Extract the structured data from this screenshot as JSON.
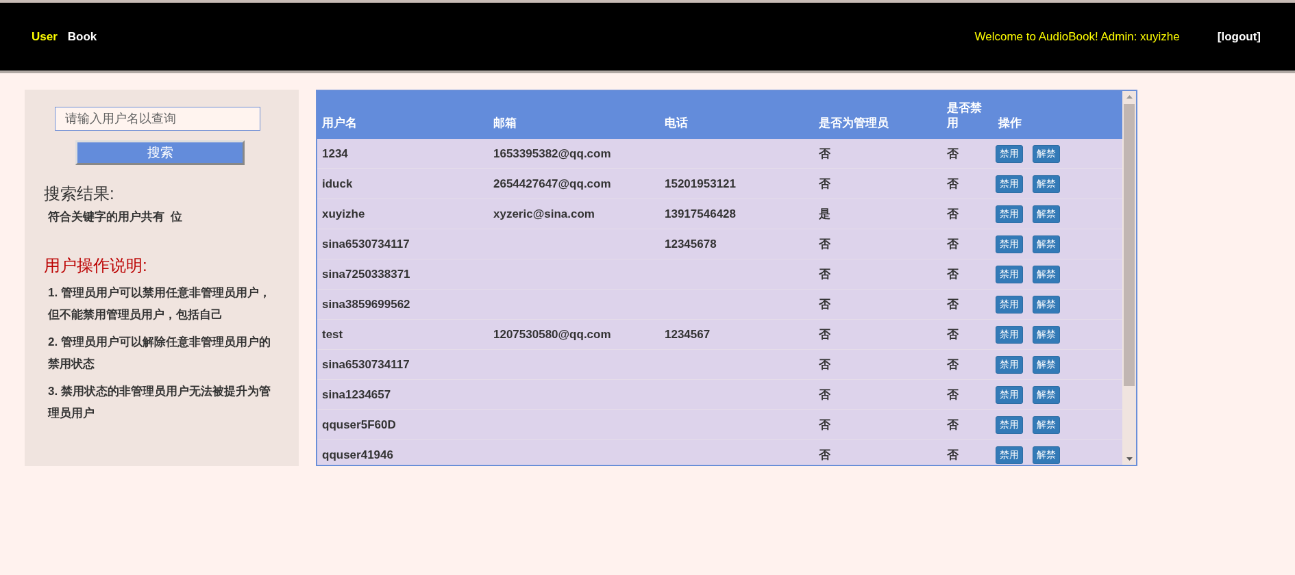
{
  "nav": {
    "items": [
      {
        "label": "User",
        "selected": true
      },
      {
        "label": "Book",
        "selected": false
      }
    ],
    "welcome": "Welcome to AudioBook! Admin: xuyizhe",
    "logout": "[logout]"
  },
  "sidebar": {
    "search": {
      "placeholder": "请输入用户名以查询",
      "button": "搜索"
    },
    "result_title": "搜索结果:",
    "result_text": "符合关键字的用户共有  位",
    "help_title": "用户操作说明:",
    "help_items": [
      "1. 管理员用户可以禁用任意非管理员用户，但不能禁用管理员用户，包括自己",
      "2. 管理员用户可以解除任意非管理员用户的禁用状态",
      "3. 禁用状态的非管理员用户无法被提升为管理员用户"
    ]
  },
  "table": {
    "columns": [
      "用户名",
      "邮箱",
      "电话",
      "是否为管理员",
      "是否禁用",
      "操作"
    ],
    "rows": [
      {
        "username": "1234",
        "email": "1653395382@qq.com",
        "phone": "",
        "admin": "否",
        "banned": "否",
        "actions": [
          "禁用",
          "解禁"
        ]
      },
      {
        "username": "iduck",
        "email": "2654427647@qq.com",
        "phone": "15201953121",
        "admin": "否",
        "banned": "否",
        "actions": [
          "禁用",
          "解禁"
        ]
      },
      {
        "username": "xuyizhe",
        "email": "xyzeric@sina.com",
        "phone": "13917546428",
        "admin": "是",
        "banned": "否",
        "actions": [
          "禁用",
          "解禁"
        ]
      },
      {
        "username": "sina6530734117",
        "email": "",
        "phone": "12345678",
        "admin": "否",
        "banned": "否",
        "actions": [
          "禁用",
          "解禁"
        ]
      },
      {
        "username": "sina7250338371",
        "email": "",
        "phone": "",
        "admin": "否",
        "banned": "否",
        "actions": [
          "禁用",
          "解禁"
        ]
      },
      {
        "username": "sina3859699562",
        "email": "",
        "phone": "",
        "admin": "否",
        "banned": "否",
        "actions": [
          "禁用",
          "解禁"
        ]
      },
      {
        "username": "test",
        "email": "1207530580@qq.com",
        "phone": "1234567",
        "admin": "否",
        "banned": "否",
        "actions": [
          "禁用",
          "解禁"
        ]
      },
      {
        "username": "sina6530734117",
        "email": "",
        "phone": "",
        "admin": "否",
        "banned": "否",
        "actions": [
          "禁用",
          "解禁"
        ]
      },
      {
        "username": "sina1234657",
        "email": "",
        "phone": "",
        "admin": "否",
        "banned": "否",
        "actions": [
          "禁用",
          "解禁"
        ]
      },
      {
        "username": "qquser5F60D",
        "email": "",
        "phone": "",
        "admin": "否",
        "banned": "否",
        "actions": [
          "禁用",
          "解禁"
        ]
      },
      {
        "username": "qquser41946",
        "email": "",
        "phone": "",
        "admin": "否",
        "banned": "否",
        "actions": [
          "禁用",
          "解禁"
        ]
      }
    ]
  }
}
